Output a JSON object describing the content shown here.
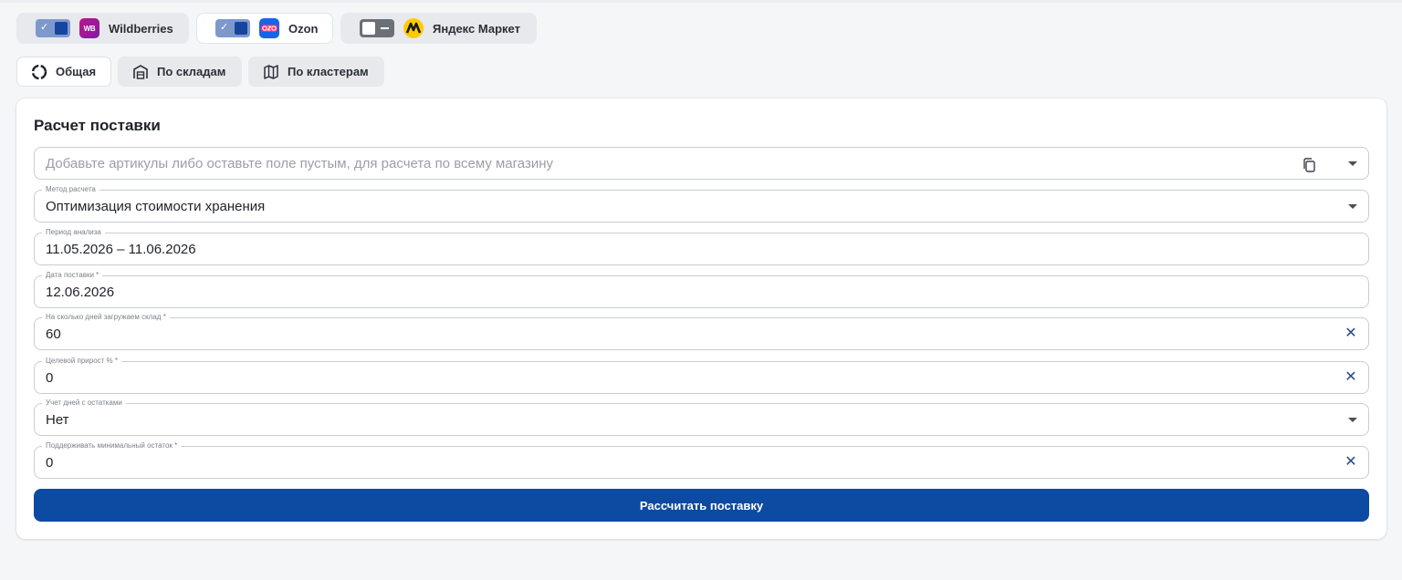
{
  "marketplaces": [
    {
      "name": "Wildberries",
      "logo_text": "WB",
      "enabled": true
    },
    {
      "name": "Ozon",
      "enabled": true
    },
    {
      "name": "Яндекс Маркет",
      "enabled": false
    }
  ],
  "tabs": [
    {
      "label": "Общая",
      "icon": "circle-dashed-icon",
      "active": true
    },
    {
      "label": "По складам",
      "icon": "warehouse-icon",
      "active": false
    },
    {
      "label": "По кластерам",
      "icon": "map-icon",
      "active": false
    }
  ],
  "form": {
    "title": "Расчет поставки",
    "articles": {
      "placeholder": "Добавьте артикулы либо оставьте поле пустым, для расчета по всему магазину",
      "value": ""
    },
    "method": {
      "label": "Метод расчета",
      "value": "Оптимизация стоимости хранения"
    },
    "period": {
      "label": "Период анализа",
      "value": "11.05.2026 – 11.06.2026"
    },
    "delivery_date": {
      "label": "Дата поставки *",
      "value": "12.06.2026"
    },
    "days_stock": {
      "label": "На сколько дней загружаем склад *",
      "value": "60"
    },
    "growth": {
      "label": "Целевой прирост % *",
      "value": "0"
    },
    "stock_days": {
      "label": "Учет дней с остатками",
      "value": "Нет"
    },
    "min_stock": {
      "label": "Поддерживать минимальный остаток *",
      "value": "0"
    },
    "submit_label": "Рассчитать поставку"
  },
  "colors": {
    "primary": "#0d4aa2",
    "toggle_on": "#7f98cc",
    "toggle_off": "#6b6f76",
    "background": "#f5f6f8"
  }
}
